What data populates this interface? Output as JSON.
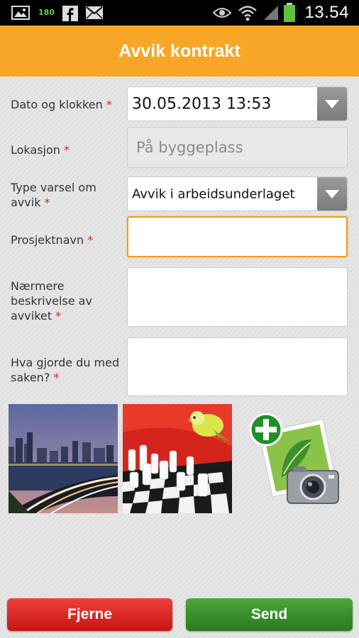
{
  "status_bar": {
    "time": "13.54",
    "badge": "180",
    "icons": [
      "image-icon",
      "counter-icon",
      "facebook-icon",
      "mail-icon",
      "eye-icon",
      "wifi-icon",
      "signal-icon",
      "battery-icon"
    ]
  },
  "header": {
    "title": "Avvik kontrakt"
  },
  "form": {
    "required_mark": "*",
    "date_label": "Dato og klokken",
    "date_value": "30.05.2013 13:53",
    "location_label": "Lokasjon",
    "location_value": "På byggeplass",
    "type_label": "Type varsel om avvik",
    "type_value": "Avvik i arbeidsunderlaget",
    "project_label": "Prosjektnavn",
    "project_value": "",
    "description_label": "Nærmere beskrivelse av avviket",
    "description_value": "",
    "action_label": "Hva gjorde du med saken?",
    "action_value": ""
  },
  "photos": {
    "items": [
      "city-night-photo",
      "chess-parakeet-photo"
    ],
    "add_icon": "add-photo-icon"
  },
  "actions": {
    "remove_label": "Fjerne",
    "send_label": "Send"
  },
  "colors": {
    "header": "#f7a626",
    "focus": "#f39a1d",
    "remove": "#d3201d",
    "send": "#349029",
    "required": "#d21f1f"
  }
}
